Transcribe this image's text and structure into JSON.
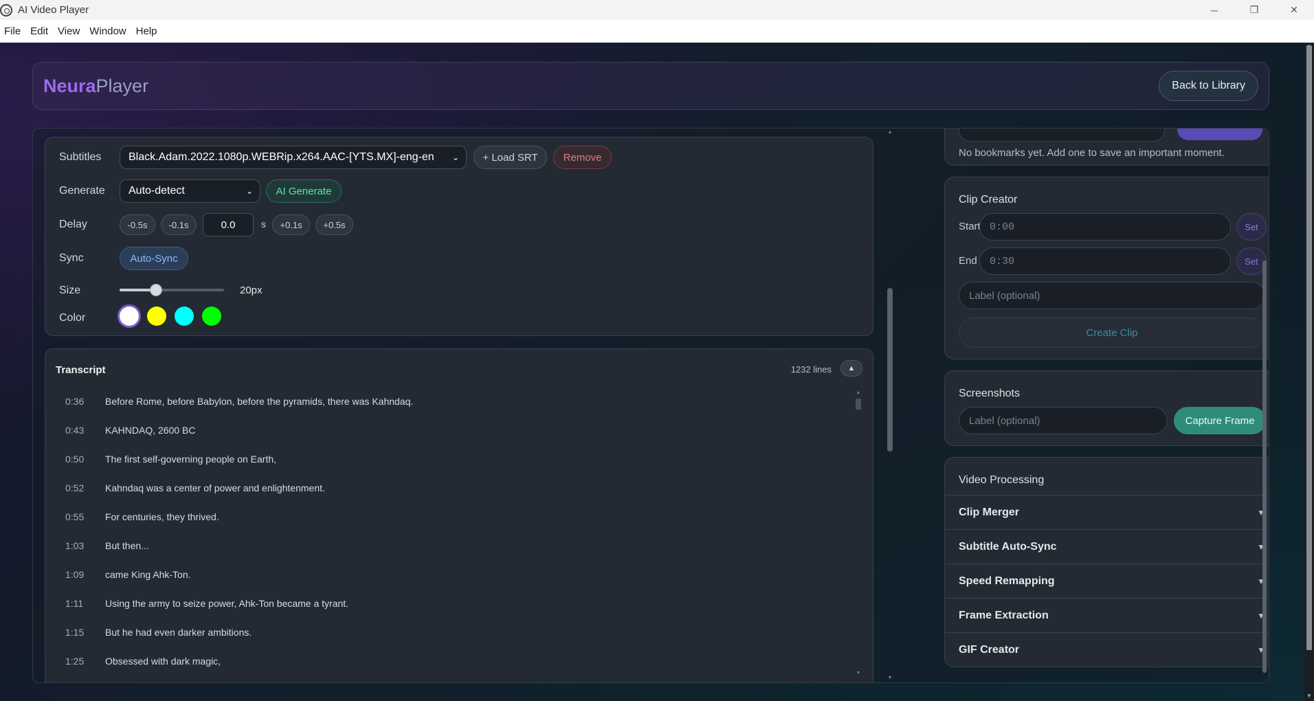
{
  "window": {
    "title": "AI Video Player",
    "controls": {
      "minimize": "─",
      "restore": "❐",
      "close": "✕"
    }
  },
  "menu": [
    "File",
    "Edit",
    "View",
    "Window",
    "Help"
  ],
  "header": {
    "logo_bold": "Neura",
    "logo_rest": "Player",
    "back_button": "Back to Library"
  },
  "subtitles": {
    "subtitles_label": "Subtitles",
    "file_selected": "Black.Adam.2022.1080p.WEBRip.x264.AAC-[YTS.MX]-eng-en",
    "load_srt": "+ Load SRT",
    "remove": "Remove",
    "generate_label": "Generate",
    "language_selected": "Auto-detect",
    "ai_generate": "AI Generate",
    "delay_label": "Delay",
    "delay_buttons": [
      "-0.5s",
      "-0.1s",
      "+0.1s",
      "+0.5s"
    ],
    "delay_value": "0.0",
    "delay_unit": "s",
    "sync_label": "Sync",
    "auto_sync": "Auto-Sync",
    "size_label": "Size",
    "size_value": "20px",
    "size_fraction": 0.35,
    "color_label": "Color",
    "colors": [
      "#ffffff",
      "#ffff00",
      "#00ffff",
      "#00ff00"
    ],
    "selected_color": "#ffffff"
  },
  "transcript": {
    "title": "Transcript",
    "count": "1232 lines",
    "collapse_icon": "▲",
    "lines": [
      {
        "time": "0:36",
        "text": "Before Rome, before Babylon, before the pyramids, there was Kahndaq."
      },
      {
        "time": "0:43",
        "text": "KAHNDAQ, 2600 BC"
      },
      {
        "time": "0:50",
        "text": "The first self-governing people on Earth,"
      },
      {
        "time": "0:52",
        "text": "Kahndaq was a center of power and enlightenment."
      },
      {
        "time": "0:55",
        "text": "For centuries, they thrived."
      },
      {
        "time": "1:03",
        "text": "But then..."
      },
      {
        "time": "1:09",
        "text": "came King Ahk-Ton."
      },
      {
        "time": "1:11",
        "text": "Using the army to seize power, Ahk-Ton became a tyrant."
      },
      {
        "time": "1:15",
        "text": "But he had even darker ambitions."
      },
      {
        "time": "1:25",
        "text": "Obsessed with dark magic,"
      }
    ]
  },
  "bookmarks": {
    "empty_text": "No bookmarks yet. Add one to save an important moment."
  },
  "clip_creator": {
    "title": "Clip Creator",
    "start_label": "Start",
    "start_placeholder": "0:00",
    "end_label": "End",
    "end_placeholder": "0:30",
    "set_label": "Set",
    "label_placeholder": "Label (optional)",
    "create_button": "Create Clip"
  },
  "screenshots": {
    "title": "Screenshots",
    "label_placeholder": "Label (optional)",
    "capture_button": "Capture Frame"
  },
  "video_processing": {
    "title": "Video Processing",
    "items": [
      "Clip Merger",
      "Subtitle Auto-Sync",
      "Speed Remapping",
      "Frame Extraction",
      "GIF Creator"
    ],
    "chevron": "▼"
  }
}
